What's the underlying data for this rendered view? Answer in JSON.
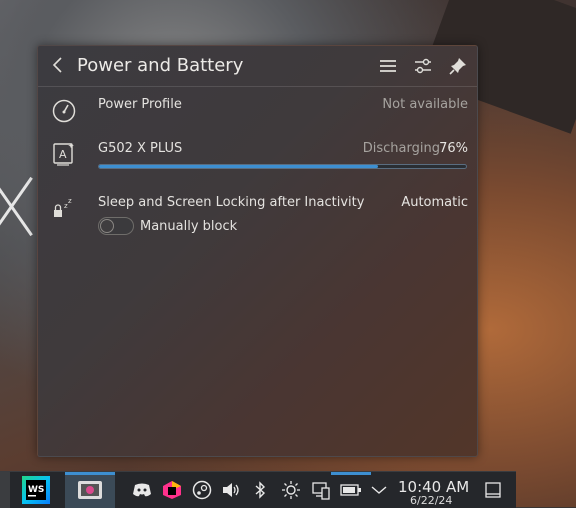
{
  "popup": {
    "title": "Power and Battery",
    "header_icons": [
      "back-arrow-icon",
      "hamburger-menu-icon",
      "configure-icon",
      "pin-icon"
    ]
  },
  "power_profile": {
    "label": "Power Profile",
    "value": "Not available",
    "icon": "speedometer-icon"
  },
  "device": {
    "name": "G502 X PLUS",
    "status": "Discharging",
    "percent": "76%",
    "charge_fraction": 0.76,
    "icon": "mouse-battery-icon"
  },
  "sleep": {
    "label": "Sleep and Screen Locking after Inactivity",
    "value": "Automatic",
    "toggle_label": "Manually block",
    "toggle_on": false,
    "icon": "lock-sleep-icon"
  },
  "taskbar": {
    "apps": [
      "webstorm-icon",
      "screenshot-app-icon"
    ],
    "tray": [
      "discord-icon",
      "jetbrains-toolbox-icon",
      "steam-icon",
      "volume-icon",
      "bluetooth-icon",
      "brightness-icon",
      "kde-connect-icon",
      "battery-icon",
      "chevron-up-icon",
      "show-desktop-icon"
    ],
    "time": "10:40 AM",
    "date": "6/22/24"
  },
  "colors": {
    "accent": "#3d8fd1",
    "panel": "#25272b"
  }
}
